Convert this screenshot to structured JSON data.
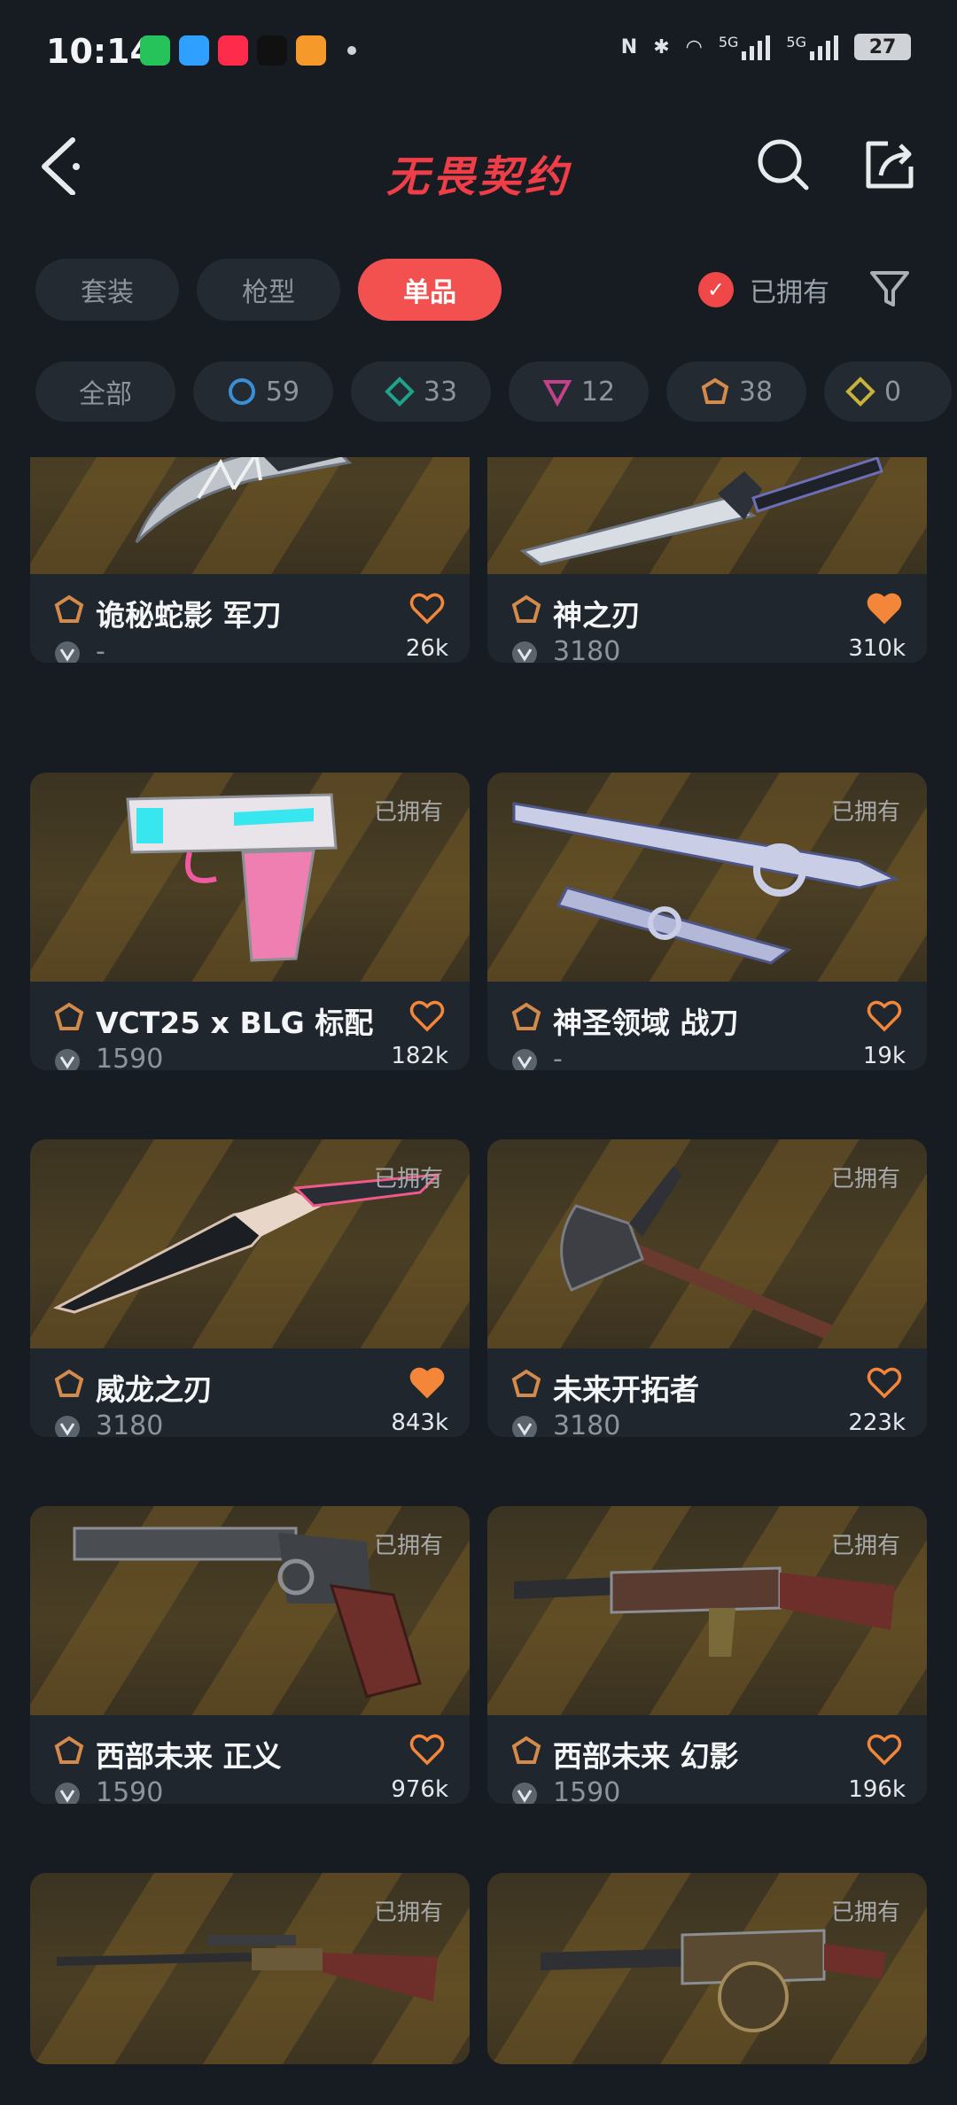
{
  "status_bar": {
    "time": "10:14",
    "battery": "27",
    "network1": "5G",
    "network2": "5G"
  },
  "header": {
    "logo": "无畏契约"
  },
  "tabs": [
    {
      "label": "套装",
      "active": false
    },
    {
      "label": "枪型",
      "active": false
    },
    {
      "label": "单品",
      "active": true
    }
  ],
  "owned_filter": {
    "label": "已拥有",
    "checked": true
  },
  "chips": [
    {
      "label": "全部"
    },
    {
      "count": "59",
      "icon": "select-tier-icon",
      "color": "#3a8fd6"
    },
    {
      "count": "33",
      "icon": "deluxe-tier-icon",
      "color": "#1ea38a"
    },
    {
      "count": "12",
      "icon": "premium-tier-icon",
      "color": "#c2418a"
    },
    {
      "count": "38",
      "icon": "exclusive-tier-icon",
      "color": "#d48a4a"
    },
    {
      "count": "0",
      "icon": "ultra-tier-icon",
      "color": "#c9b23a"
    }
  ],
  "cards": [
    {
      "name": "诡秘蛇影 军刀",
      "price": "-",
      "likes": "26k",
      "owned": false,
      "liked": false
    },
    {
      "name": "神之刃",
      "price": "3180",
      "likes": "310k",
      "owned": false,
      "liked": true
    },
    {
      "name": "VCT25 x BLG 标配",
      "price": "1590",
      "likes": "182k",
      "owned": true,
      "owned_label": "已拥有",
      "liked": false
    },
    {
      "name": "神圣领域 战刀",
      "price": "-",
      "likes": "19k",
      "owned": true,
      "owned_label": "已拥有",
      "liked": false
    },
    {
      "name": "威龙之刃",
      "price": "3180",
      "likes": "843k",
      "owned": true,
      "owned_label": "已拥有",
      "liked": true
    },
    {
      "name": "未来开拓者",
      "price": "3180",
      "likes": "223k",
      "owned": true,
      "owned_label": "已拥有",
      "liked": false
    },
    {
      "name": "西部未来 正义",
      "price": "1590",
      "likes": "976k",
      "owned": true,
      "owned_label": "已拥有",
      "liked": false
    },
    {
      "name": "西部未来 幻影",
      "price": "1590",
      "likes": "196k",
      "owned": true,
      "owned_label": "已拥有",
      "liked": false
    },
    {
      "owned": true,
      "owned_label": "已拥有"
    },
    {
      "owned": true,
      "owned_label": "已拥有"
    }
  ],
  "colors": {
    "accent": "#f35050",
    "tier_exclusive": "#d48a4a",
    "heart_active": "#f4863a"
  }
}
